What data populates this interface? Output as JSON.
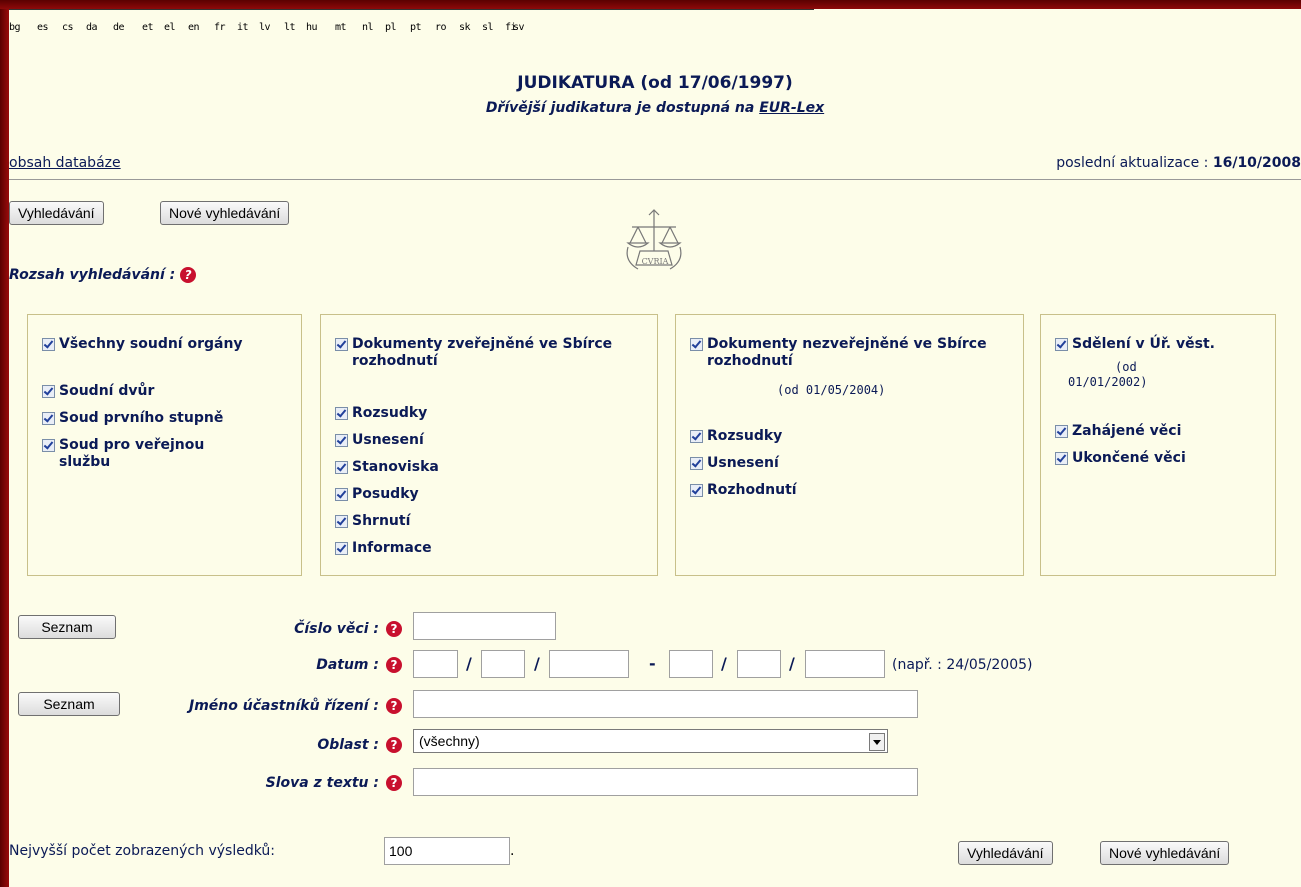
{
  "languages": [
    "bg",
    "es",
    "cs",
    "da",
    "de",
    "et",
    "el",
    "en",
    "fr",
    "it",
    "lv",
    "lt",
    "hu",
    "mt",
    "nl",
    "pl",
    "pt",
    "ro",
    "sk",
    "sl",
    "fi",
    "sv"
  ],
  "header": {
    "title": "JUDIKATURA (od 17/06/1997)",
    "subtitle_prefix": "Dřívější judikatura je dostupná na",
    "subtitle_link": "EUR-Lex"
  },
  "database_link": "obsah databáze",
  "last_update_label": "poslední aktualizace : ",
  "last_update_value": "16/10/2008",
  "buttons": {
    "search": "Vyhledávání",
    "new_search": "Nové vyhledávání",
    "list": "Seznam"
  },
  "logo_text": "CVRIA",
  "scope_label": "Rozsah vyhledávání :",
  "help_glyph": "?",
  "panels": {
    "courts": {
      "all": "Všechny soudní orgány",
      "items": [
        "Soudní dvůr",
        "Soud prvního stupně",
        "Soud pro veřejnou službu"
      ]
    },
    "published": {
      "title": "Dokumenty zveřejněné ve Sbírce rozhodnutí",
      "items": [
        "Rozsudky",
        "Usnesení",
        "Stanoviska",
        "Posudky",
        "Shrnutí",
        "Informace"
      ]
    },
    "unpublished": {
      "title": "Dokumenty nezveřejněné ve Sbírce rozhodnutí",
      "note": "(od 01/05/2004)",
      "items": [
        "Rozsudky",
        "Usnesení",
        "Rozhodnutí"
      ]
    },
    "oj": {
      "title": "Sdělení v Úř. věst.",
      "note1": "(od",
      "note2": "01/01/2002)",
      "items": [
        "Zahájené věci",
        "Ukončené věci"
      ]
    }
  },
  "fields": {
    "case_number": "Číslo věci :",
    "date": "Datum :",
    "date_hint": "(např. : 24/05/2005)",
    "date_sep": "/",
    "date_range_sep": "-",
    "parties": "Jméno účastníků řízení :",
    "area": "Oblast :",
    "area_value": "(všechny)",
    "words": "Slova z textu :"
  },
  "max_results_label": "Nejvyšší počet zobrazených výsledků:",
  "max_results_value": "100",
  "period": "."
}
